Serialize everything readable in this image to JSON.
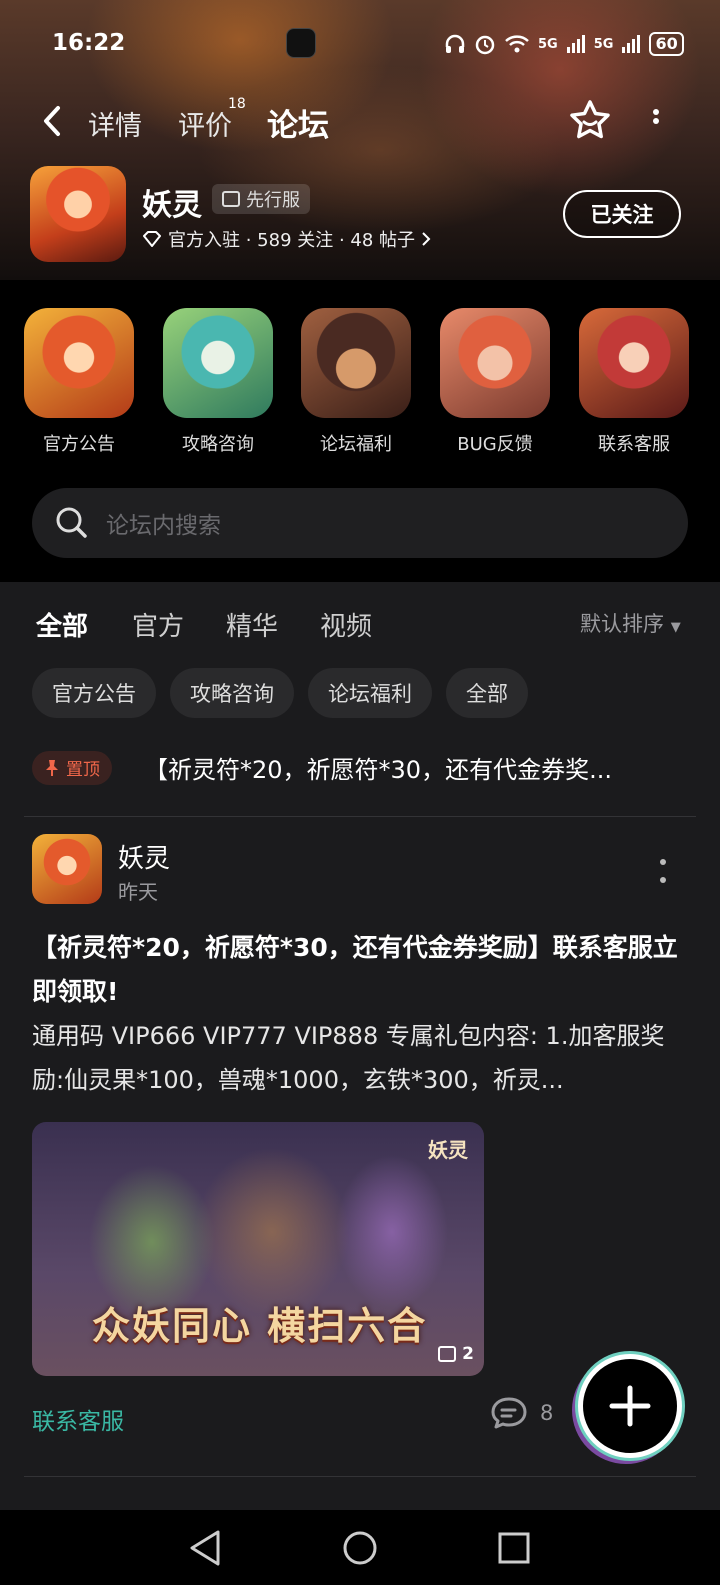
{
  "status_bar": {
    "time": "16:22",
    "network1": "5G",
    "network2": "5G",
    "battery": "60"
  },
  "nav": {
    "tabs": [
      {
        "label": "详情"
      },
      {
        "label": "评价",
        "badge": "18"
      },
      {
        "label": "论坛"
      }
    ]
  },
  "game": {
    "name": "妖灵",
    "badge": "先行服",
    "meta": "官方入驻 · 589 关注 · 48 帖子",
    "follow_label": "已关注"
  },
  "categories": [
    {
      "label": "官方公告"
    },
    {
      "label": "攻略咨询"
    },
    {
      "label": "论坛福利"
    },
    {
      "label": "BUG反馈"
    },
    {
      "label": "联系客服"
    }
  ],
  "search": {
    "placeholder": "论坛内搜索"
  },
  "feed_tabs": [
    {
      "label": "全部"
    },
    {
      "label": "官方"
    },
    {
      "label": "精华"
    },
    {
      "label": "视频"
    }
  ],
  "sort_label": "默认排序",
  "chips": [
    {
      "label": "官方公告"
    },
    {
      "label": "攻略咨询"
    },
    {
      "label": "论坛福利"
    },
    {
      "label": "全部"
    }
  ],
  "pinned": {
    "badge": "置顶",
    "title": "【祈灵符*20，祈愿符*30，还有代金券奖..."
  },
  "post": {
    "author": "妖灵",
    "time": "昨天",
    "title": "【祈灵符*20，祈愿符*30，还有代金券奖励】联系客服立即领取!",
    "body": "通用码 VIP666 VIP777 VIP888 专属礼包内容: 1.加客服奖励:仙灵果*100，兽魂*1000，玄铁*300，祈灵...",
    "image_logo": "妖灵",
    "image_caption": "众妖同心 横扫六合",
    "image_count": "2",
    "tag": "联系客服",
    "comments": "8"
  },
  "colors": {
    "accent": "#22b8a4",
    "pin": "#f0674a",
    "background": "#1b1b1d"
  }
}
